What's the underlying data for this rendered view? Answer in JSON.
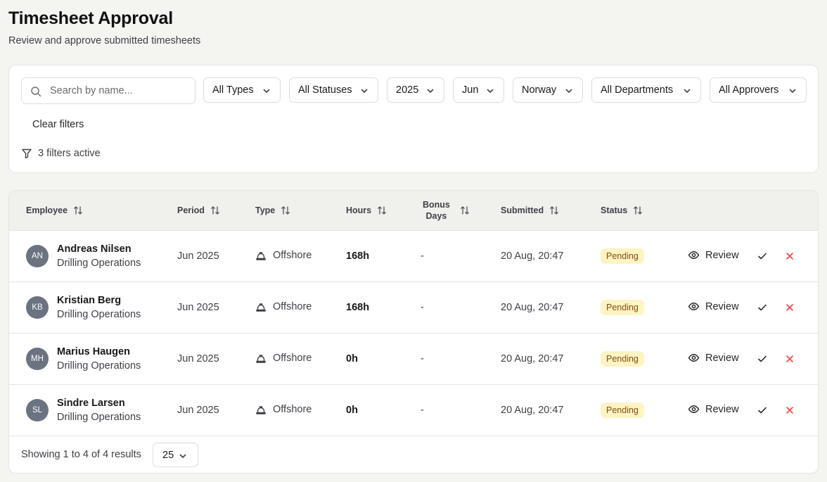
{
  "header": {
    "title": "Timesheet Approval",
    "subtitle": "Review and approve submitted timesheets"
  },
  "filters": {
    "search_placeholder": "Search by name...",
    "type": "All Types",
    "status": "All Statuses",
    "year": "2025",
    "month": "Jun",
    "country": "Norway",
    "department": "All Departments",
    "approver": "All Approvers",
    "clear_label": "Clear filters",
    "active_label": "3 filters active"
  },
  "table": {
    "columns": {
      "employee": "Employee",
      "period": "Period",
      "type": "Type",
      "hours": "Hours",
      "bonus_line1": "Bonus",
      "bonus_line2": "Days",
      "submitted": "Submitted",
      "status": "Status"
    },
    "rows": [
      {
        "initials": "AN",
        "name": "Andreas Nilsen",
        "department": "Drilling Operations",
        "period": "Jun 2025",
        "type": "Offshore",
        "hours": "168h",
        "bonus_days": "-",
        "submitted": "20 Aug, 20:47",
        "status": "Pending",
        "review": "Review"
      },
      {
        "initials": "KB",
        "name": "Kristian Berg",
        "department": "Drilling Operations",
        "period": "Jun 2025",
        "type": "Offshore",
        "hours": "168h",
        "bonus_days": "-",
        "submitted": "20 Aug, 20:47",
        "status": "Pending",
        "review": "Review"
      },
      {
        "initials": "MH",
        "name": "Marius Haugen",
        "department": "Drilling Operations",
        "period": "Jun 2025",
        "type": "Offshore",
        "hours": "0h",
        "bonus_days": "-",
        "submitted": "20 Aug, 20:47",
        "status": "Pending",
        "review": "Review"
      },
      {
        "initials": "SL",
        "name": "Sindre Larsen",
        "department": "Drilling Operations",
        "period": "Jun 2025",
        "type": "Offshore",
        "hours": "0h",
        "bonus_days": "-",
        "submitted": "20 Aug, 20:47",
        "status": "Pending",
        "review": "Review"
      }
    ]
  },
  "footer": {
    "results_text": "Showing 1 to 4 of 4 results",
    "per_page": "25"
  },
  "colors": {
    "background": "#f4f4f1",
    "pending_bg": "#fdf4c3",
    "pending_text": "#854d0e",
    "reject": "#ef4444",
    "avatar": "#6b7280"
  },
  "icons": {
    "search": "search-icon",
    "chevron": "chevron-down-icon",
    "filter": "filter-icon",
    "sort": "sort-icon",
    "offshore": "hard-hat-icon",
    "review": "eye-icon",
    "approve": "check-icon",
    "reject": "x-icon"
  }
}
